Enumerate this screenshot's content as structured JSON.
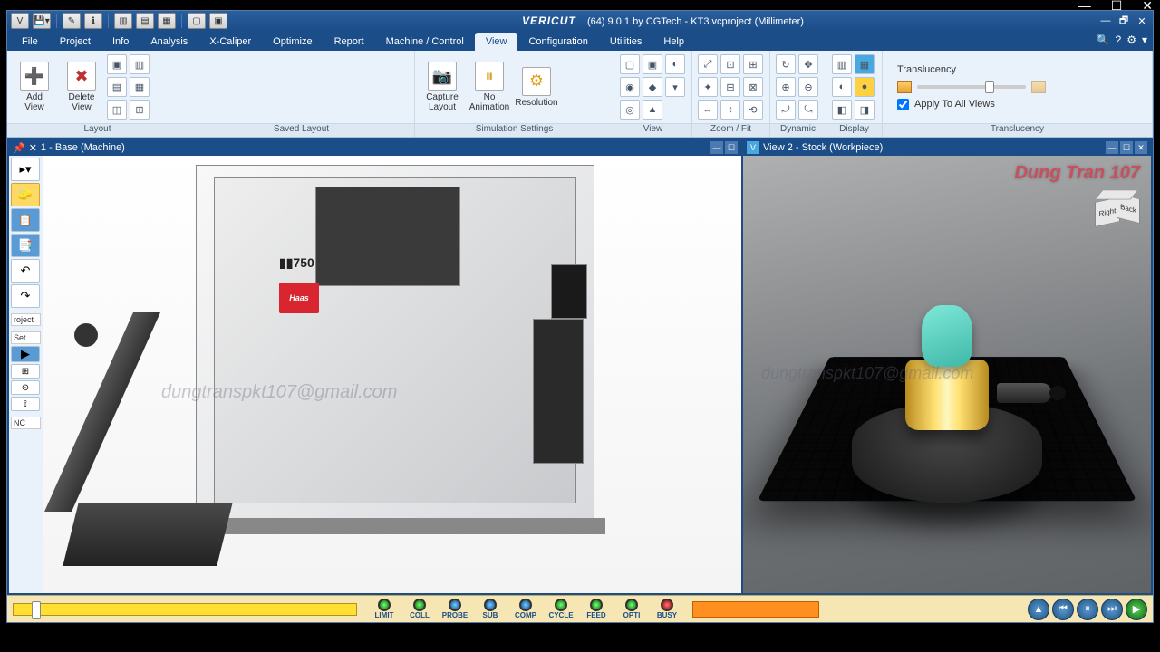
{
  "window": {
    "brand": "VERICUT",
    "title": "(64)  9.0.1 by CGTech - KT3.vcproject (Millimeter)"
  },
  "menu": {
    "items": [
      "File",
      "Project",
      "Info",
      "Analysis",
      "X-Caliper",
      "Optimize",
      "Report",
      "Machine / Control",
      "View",
      "Configuration",
      "Utilities",
      "Help"
    ],
    "active": "View"
  },
  "ribbon": {
    "layout": {
      "add": "Add\nView",
      "del": "Delete\nView",
      "label": "Layout"
    },
    "saved": {
      "label": "Saved Layout"
    },
    "capture": {
      "btn": "Capture\nLayout"
    },
    "anim": {
      "btn": "No\nAnimation"
    },
    "res": {
      "btn": "Resolution"
    },
    "sim_label": "Simulation Settings",
    "view_label": "View",
    "zoom_label": "Zoom / Fit",
    "dyn_label": "Dynamic",
    "disp_label": "Display",
    "trans": {
      "title": "Translucency",
      "apply": "Apply To All Views",
      "label": "Translucency"
    }
  },
  "views": {
    "v1": "1 - Base (Machine)",
    "v2": "View 2 - Stock (Workpiece)"
  },
  "side": {
    "project": "roject",
    "setup": "Set",
    "nc": "NC"
  },
  "watermark1": "dungtranspkt107@gmail.com",
  "watermark2": "dungtranspkt107@gmail.com",
  "brand2": "Dung Tran 107",
  "navcube": {
    "r": "Right",
    "b": "Back"
  },
  "machine": {
    "model": "750",
    "logo": "Haas"
  },
  "leds": [
    "LIMIT",
    "COLL",
    "PROBE",
    "SUB",
    "COMP",
    "CYCLE",
    "FEED",
    "OPTI",
    "BUSY"
  ],
  "led_colors": [
    "g",
    "g",
    "b",
    "b",
    "b",
    "g",
    "g",
    "g",
    "r"
  ]
}
